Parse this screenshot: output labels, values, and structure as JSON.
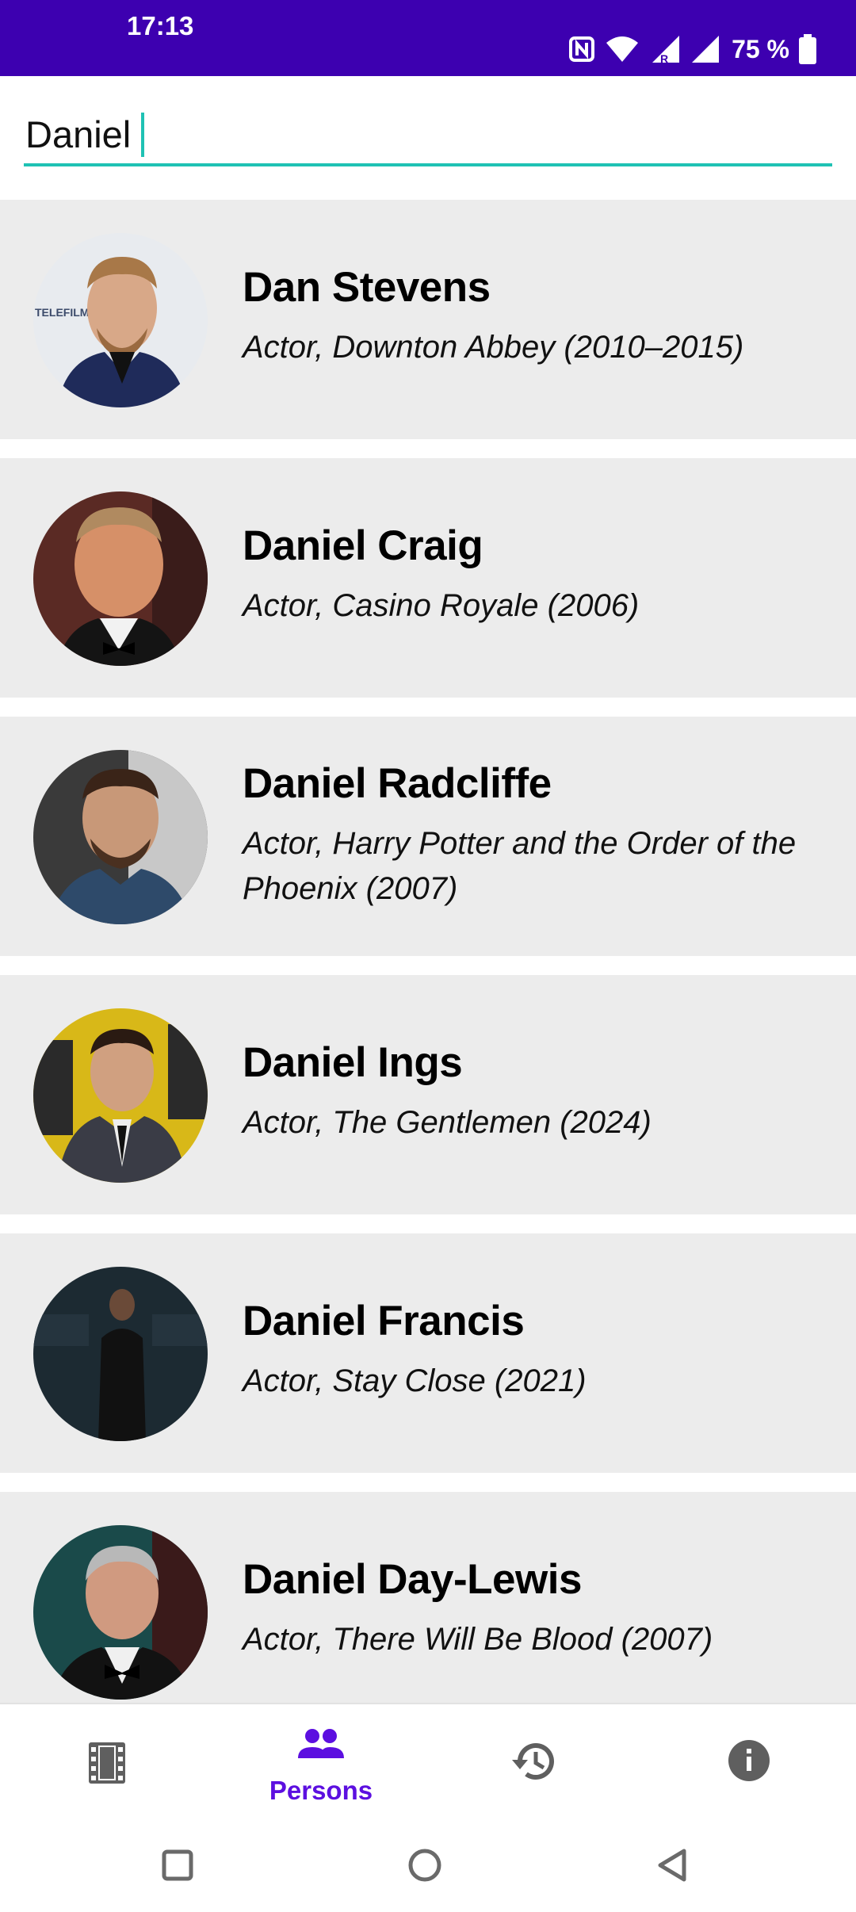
{
  "status_bar": {
    "time": "17:13",
    "battery": "75 %",
    "icons": [
      "nfc-icon",
      "wifi-icon",
      "signal-roaming-icon",
      "signal-icon",
      "battery-icon"
    ]
  },
  "search": {
    "value": "Daniel"
  },
  "persons": [
    {
      "name": "Dan Stevens",
      "role": "Actor, Downton Abbey (2010–2015)"
    },
    {
      "name": "Daniel Craig",
      "role": "Actor, Casino Royale (2006)"
    },
    {
      "name": "Daniel Radcliffe",
      "role": "Actor, Harry Potter and the Order of the Phoenix (2007)"
    },
    {
      "name": "Daniel Ings",
      "role": "Actor, The Gentlemen (2024)"
    },
    {
      "name": "Daniel Francis",
      "role": "Actor, Stay Close (2021)"
    },
    {
      "name": "Daniel Day-Lewis",
      "role": "Actor, There Will Be Blood (2007)"
    }
  ],
  "bottom_nav": {
    "items": [
      {
        "icon": "film-icon",
        "label": ""
      },
      {
        "icon": "persons-icon",
        "label": "Persons",
        "active": true
      },
      {
        "icon": "history-icon",
        "label": ""
      },
      {
        "icon": "info-icon",
        "label": ""
      }
    ]
  },
  "colors": {
    "status_bar": "#3d00b0",
    "accent": "#5c0fe0",
    "search_underline": "#1fc2b4",
    "item_background": "#ececec",
    "nav_icon_inactive": "#5f5f5f"
  }
}
